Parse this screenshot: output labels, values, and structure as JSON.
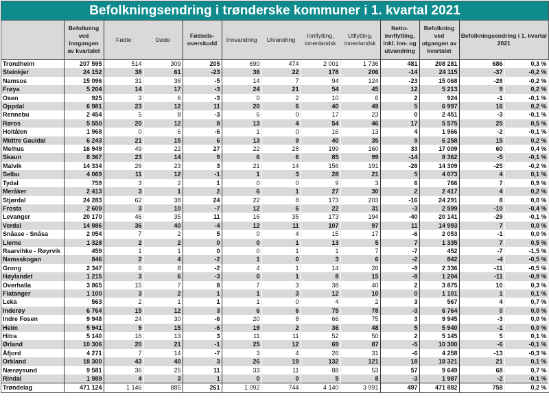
{
  "title": "Befolkningsendring  i trønderske kommuner i 1. kvartal 2021",
  "headers": [
    "",
    "Befolkning ved inngangen av kvartalet",
    "Fødte",
    "Døde",
    "Fødsels-overskudd",
    "Innvandring",
    "Utvandring",
    "Innflytting, innenlandsk",
    "Utflytting, innenlandsk",
    "Netto-innflytting, inkl. inn- og utvandring",
    "Befolkning ved utgangen av kvartalet",
    "Befolkningsendring i 1. kvartal 2021"
  ],
  "rows": [
    [
      "Trondheim",
      "207 595",
      "514",
      "309",
      "205",
      "690",
      "474",
      "2 001",
      "1 736",
      "481",
      "208 281",
      "686",
      "0,3 %"
    ],
    [
      "Steinkjer",
      "24 152",
      "38",
      "61",
      "-23",
      "36",
      "22",
      "178",
      "206",
      "-14",
      "24 115",
      "-37",
      "-0,2 %"
    ],
    [
      "Namsos",
      "15 096",
      "31",
      "36",
      "-5",
      "14",
      "7",
      "94",
      "124",
      "-23",
      "15 068",
      "-28",
      "-0,2 %"
    ],
    [
      "Frøya",
      "5 204",
      "14",
      "17",
      "-3",
      "24",
      "21",
      "54",
      "45",
      "12",
      "5 213",
      "9",
      "0,2 %"
    ],
    [
      "Osen",
      "925",
      "3",
      "6",
      "-3",
      "0",
      "2",
      "10",
      "6",
      "2",
      "924",
      "-1",
      "-0,1 %"
    ],
    [
      "Oppdal",
      "6 981",
      "23",
      "12",
      "11",
      "20",
      "6",
      "40",
      "49",
      "5",
      "6 997",
      "16",
      "0,2 %"
    ],
    [
      "Rennebu",
      "2 454",
      "5",
      "8",
      "-3",
      "6",
      "0",
      "17",
      "23",
      "0",
      "2 451",
      "-3",
      "-0,1 %"
    ],
    [
      "Røros",
      "5 550",
      "20",
      "12",
      "8",
      "13",
      "4",
      "54",
      "46",
      "17",
      "5 575",
      "25",
      "0,5 %"
    ],
    [
      "Holtålen",
      "1 968",
      "0",
      "6",
      "-6",
      "1",
      "0",
      "16",
      "13",
      "4",
      "1 966",
      "-2",
      "-0,1 %"
    ],
    [
      "Midtre Gauldal",
      "6 243",
      "21",
      "15",
      "6",
      "13",
      "9",
      "40",
      "35",
      "9",
      "6 258",
      "15",
      "0,2 %"
    ],
    [
      "Melhus",
      "16 949",
      "49",
      "22",
      "27",
      "22",
      "28",
      "199",
      "160",
      "33",
      "17 009",
      "60",
      "0,4 %"
    ],
    [
      "Skaun",
      "8 367",
      "23",
      "14",
      "9",
      "6",
      "6",
      "85",
      "99",
      "-14",
      "8 362",
      "-5",
      "-0,1 %"
    ],
    [
      "Malvik",
      "14 334",
      "26",
      "23",
      "3",
      "21",
      "14",
      "156",
      "191",
      "-28",
      "14 309",
      "-25",
      "-0,2 %"
    ],
    [
      "Selbu",
      "4 069",
      "11",
      "12",
      "-1",
      "1",
      "3",
      "28",
      "21",
      "5",
      "4 073",
      "4",
      "0,1 %"
    ],
    [
      "Tydal",
      "759",
      "3",
      "2",
      "1",
      "0",
      "0",
      "9",
      "3",
      "6",
      "766",
      "7",
      "0,9 %"
    ],
    [
      "Meråker",
      "2 413",
      "3",
      "1",
      "2",
      "6",
      "1",
      "27",
      "30",
      "2",
      "2 417",
      "4",
      "0,2 %"
    ],
    [
      "Stjørdal",
      "24 283",
      "62",
      "38",
      "24",
      "22",
      "8",
      "173",
      "203",
      "-16",
      "24 291",
      "8",
      "0,0 %"
    ],
    [
      "Frosta",
      "2 609",
      "3",
      "10",
      "-7",
      "12",
      "6",
      "22",
      "31",
      "-3",
      "2 599",
      "-10",
      "-0,4 %"
    ],
    [
      "Levanger",
      "20 170",
      "46",
      "35",
      "11",
      "16",
      "35",
      "173",
      "194",
      "-40",
      "20 141",
      "-29",
      "-0,1 %"
    ],
    [
      "Verdal",
      "14 986",
      "36",
      "40",
      "-4",
      "12",
      "11",
      "107",
      "97",
      "11",
      "14 993",
      "7",
      "0,0 %"
    ],
    [
      "Snåase - Snåsa",
      "2 054",
      "7",
      "2",
      "5",
      "0",
      "4",
      "15",
      "17",
      "-6",
      "2 053",
      "-1",
      "0,0 %"
    ],
    [
      "Lierne",
      "1 328",
      "2",
      "2",
      "0",
      "0",
      "1",
      "13",
      "5",
      "7",
      "1 335",
      "7",
      "0,5 %"
    ],
    [
      "Raarvihke - Røyrvik",
      "459",
      "1",
      "1",
      "0",
      "0",
      "1",
      "1",
      "7",
      "-7",
      "452",
      "-7",
      "-1,5 %"
    ],
    [
      "Namsskogan",
      "846",
      "2",
      "4",
      "-2",
      "1",
      "0",
      "3",
      "6",
      "-2",
      "842",
      "-4",
      "-0,5 %"
    ],
    [
      "Grong",
      "2 347",
      "6",
      "8",
      "-2",
      "4",
      "1",
      "14",
      "26",
      "-9",
      "2 336",
      "-11",
      "-0,5 %"
    ],
    [
      "Høylandet",
      "1 215",
      "3",
      "6",
      "-3",
      "0",
      "1",
      "8",
      "15",
      "-8",
      "1 204",
      "-11",
      "-0,9 %"
    ],
    [
      "Overhalla",
      "3 865",
      "15",
      "7",
      "8",
      "7",
      "3",
      "38",
      "40",
      "2",
      "3 875",
      "10",
      "0,3 %"
    ],
    [
      "Flatanger",
      "1 100",
      "3",
      "2",
      "1",
      "1",
      "3",
      "12",
      "10",
      "0",
      "1 101",
      "1",
      "0,1 %"
    ],
    [
      "Leka",
      "563",
      "2",
      "1",
      "1",
      "1",
      "0",
      "4",
      "2",
      "3",
      "567",
      "4",
      "0,7 %"
    ],
    [
      "Inderøy",
      "6 764",
      "15",
      "12",
      "3",
      "6",
      "6",
      "75",
      "78",
      "-3",
      "6 764",
      "0",
      "0,0 %"
    ],
    [
      "Indre Fosen",
      "9 948",
      "24",
      "30",
      "-6",
      "20",
      "8",
      "66",
      "75",
      "3",
      "9 945",
      "-3",
      "0,0 %"
    ],
    [
      "Heim",
      "5 941",
      "9",
      "15",
      "-6",
      "19",
      "2",
      "36",
      "48",
      "5",
      "5 940",
      "-1",
      "0,0 %"
    ],
    [
      "Hitra",
      "5 140",
      "16",
      "13",
      "3",
      "11",
      "11",
      "52",
      "50",
      "2",
      "5 145",
      "5",
      "0,1 %"
    ],
    [
      "Ørland",
      "10 306",
      "20",
      "21",
      "-1",
      "25",
      "12",
      "69",
      "87",
      "-5",
      "10 300",
      "-6",
      "-0,1 %"
    ],
    [
      "Åfjord",
      "4 271",
      "7",
      "14",
      "-7",
      "3",
      "4",
      "26",
      "31",
      "-6",
      "4 258",
      "-13",
      "-0,3 %"
    ],
    [
      "Orkland",
      "18 300",
      "43",
      "40",
      "3",
      "26",
      "19",
      "132",
      "121",
      "18",
      "18 321",
      "21",
      "0,1 %"
    ],
    [
      "Nærøysund",
      "9 581",
      "36",
      "25",
      "11",
      "33",
      "11",
      "88",
      "53",
      "57",
      "9 649",
      "68",
      "0,7 %"
    ],
    [
      "Rindal",
      "1 989",
      "4",
      "3",
      "1",
      "0",
      "0",
      "5",
      "8",
      "-3",
      "1 987",
      "-2",
      "-0,1 %"
    ]
  ],
  "total": [
    "Trøndelag",
    "471 124",
    "1 146",
    "885",
    "261",
    "1 092",
    "744",
    "4 140",
    "3 991",
    "497",
    "471 882",
    "758",
    "0,2 %"
  ]
}
